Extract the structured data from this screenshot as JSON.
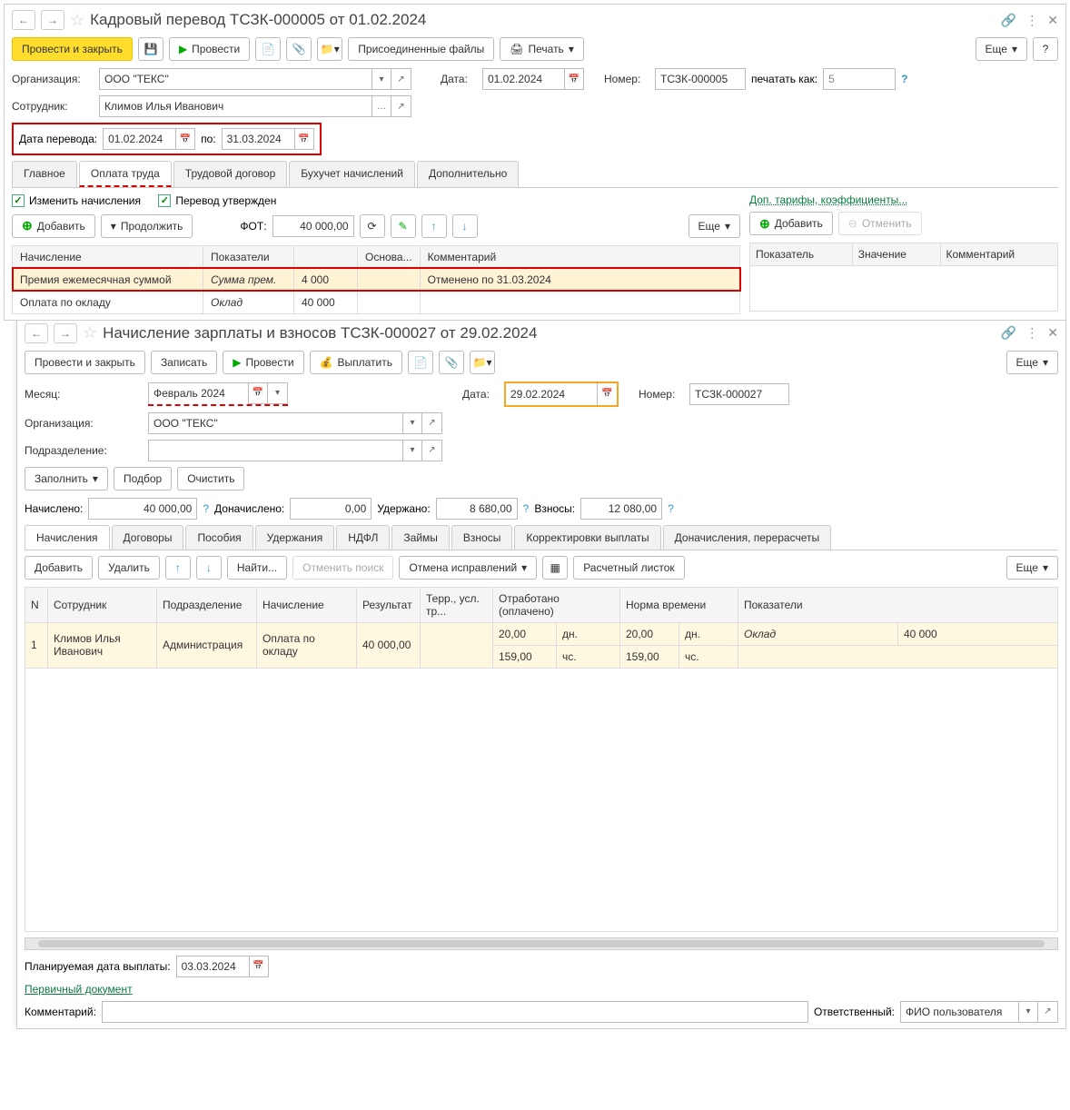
{
  "win1": {
    "title": "Кадровый перевод ТСЗК-000005 от 01.02.2024",
    "toolbar": {
      "post_close": "Провести и закрыть",
      "post": "Провести",
      "attached": "Присоединенные файлы",
      "print": "Печать",
      "more": "Еще",
      "help": "?"
    },
    "fields": {
      "org_label": "Организация:",
      "org_value": "ООО \"ТЕКС\"",
      "date_label": "Дата:",
      "date_value": "01.02.2024",
      "number_label": "Номер:",
      "number_value": "ТСЗК-000005",
      "print_as_label": "печатать как:",
      "print_as_value": "5",
      "employee_label": "Сотрудник:",
      "employee_value": "Климов Илья Иванович",
      "transfer_date_label": "Дата перевода:",
      "transfer_date_value": "01.02.2024",
      "to_label": "по:",
      "to_value": "31.03.2024"
    },
    "tabs": [
      "Главное",
      "Оплата труда",
      "Трудовой договор",
      "Бухучет начислений",
      "Дополнительно"
    ],
    "checkboxes": {
      "change_accruals": "Изменить начисления",
      "transfer_approved": "Перевод утвержден"
    },
    "buttons": {
      "add": "Добавить",
      "continue": "Продолжить",
      "more": "Еще"
    },
    "fot_label": "ФОТ:",
    "fot_value": "40 000,00",
    "main_table": {
      "headers": [
        "Начисление",
        "Показатели",
        "",
        "Основа...",
        "Комментарий"
      ],
      "rows": [
        {
          "c0": "Премия ежемесячная суммой",
          "c1": "Сумма прем.",
          "c2": "4 000",
          "c3": "",
          "c4": "Отменено по 31.03.2024"
        },
        {
          "c0": "Оплата по окладу",
          "c1": "Оклад",
          "c2": "40 000",
          "c3": "",
          "c4": ""
        }
      ]
    },
    "side": {
      "title": "Доп. тарифы, коэффициенты...",
      "add": "Добавить",
      "cancel": "Отменить",
      "headers": [
        "Показатель",
        "Значение",
        "Комментарий"
      ]
    }
  },
  "win2": {
    "title": "Начисление зарплаты и взносов ТСЗК-000027 от 29.02.2024",
    "toolbar": {
      "post_close": "Провести и закрыть",
      "save": "Записать",
      "post": "Провести",
      "pay": "Выплатить",
      "more": "Еще"
    },
    "fields": {
      "month_label": "Месяц:",
      "month_value": "Февраль 2024",
      "date_label": "Дата:",
      "date_value": "29.02.2024",
      "number_label": "Номер:",
      "number_value": "ТСЗК-000027",
      "org_label": "Организация:",
      "org_value": "ООО \"ТЕКС\"",
      "dept_label": "Подразделение:",
      "dept_value": ""
    },
    "buttons": {
      "fill": "Заполнить",
      "select": "Подбор",
      "clear": "Очистить"
    },
    "sums": {
      "accrued_label": "Начислено:",
      "accrued_value": "40 000,00",
      "extra_label": "Доначислено:",
      "extra_value": "0,00",
      "withheld_label": "Удержано:",
      "withheld_value": "8 680,00",
      "contrib_label": "Взносы:",
      "contrib_value": "12 080,00"
    },
    "tabs": [
      "Начисления",
      "Договоры",
      "Пособия",
      "Удержания",
      "НДФЛ",
      "Займы",
      "Взносы",
      "Корректировки выплаты",
      "Доначисления, перерасчеты"
    ],
    "tb2": {
      "add": "Добавить",
      "delete": "Удалить",
      "find": "Найти...",
      "cancel_search": "Отменить поиск",
      "cancel_fix": "Отмена исправлений",
      "payslip": "Расчетный листок",
      "more": "Еще"
    },
    "grid": {
      "headers": [
        "N",
        "Сотрудник",
        "Подразделение",
        "Начисление",
        "Результат",
        "Терр., усл. тр...",
        "Отработано (оплачено)",
        "",
        "Норма времени",
        "",
        "Показатели",
        ""
      ],
      "row": {
        "n": "1",
        "emp": "Климов Илья Иванович",
        "dept": "Администрация",
        "accr": "Оплата по окладу",
        "result": "40 000,00",
        "terr": "",
        "worked_d": "20,00",
        "worked_du": "дн.",
        "worked_h": "159,00",
        "worked_hu": "чс.",
        "norm_d": "20,00",
        "norm_du": "дн.",
        "norm_h": "159,00",
        "norm_hu": "чс.",
        "ind": "Оклад",
        "ind_v": "40 000"
      }
    },
    "footer": {
      "planned_label": "Планируемая дата выплаты:",
      "planned_value": "03.03.2024",
      "primary_doc": "Первичный документ",
      "comment_label": "Комментарий:",
      "resp_label": "Ответственный:",
      "resp_value": "ФИО пользователя"
    }
  }
}
